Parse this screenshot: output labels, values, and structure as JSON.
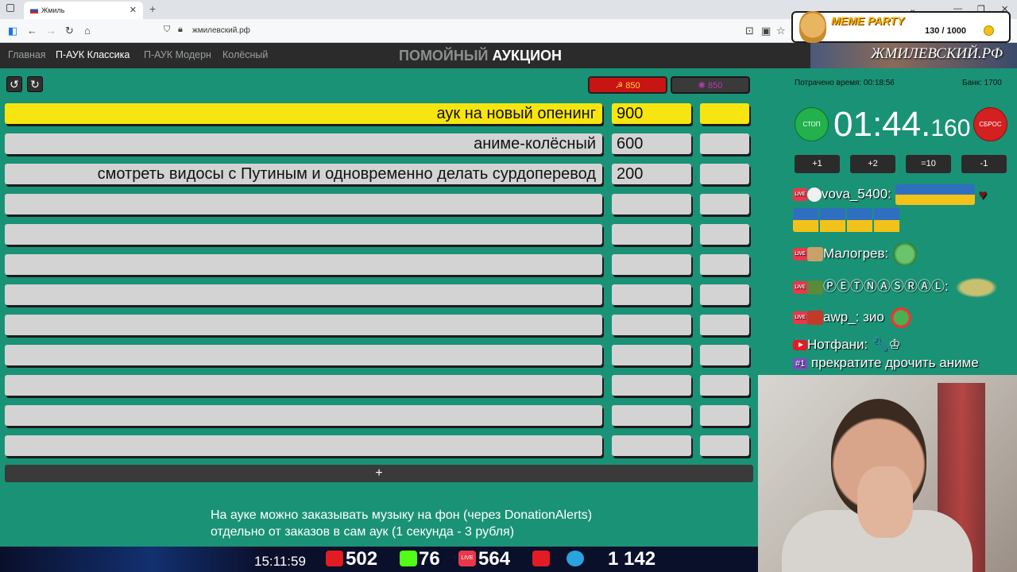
{
  "browser": {
    "tab_title": "Жмиль",
    "url": "жмилевский.рф"
  },
  "meme_party": {
    "title": "MEME PARTY",
    "count": "130 / 1000"
  },
  "nav": {
    "items": [
      "Главная",
      "П-АУК Классика",
      "П-АУК Модерн",
      "Колёсный"
    ],
    "active": "П-АУК Классика",
    "title_part1": "ПОМОЙНЫЙ",
    "title_part2": "АУКЦИОН",
    "banner": "ЖМИЛЕВСКИЙ.РФ"
  },
  "votes": {
    "red": "☭ 850",
    "dark": "850"
  },
  "lots": [
    {
      "name": "аук на новый опенинг",
      "amount": "900",
      "highlight": true
    },
    {
      "name": "аниме-колёсный",
      "amount": "600"
    },
    {
      "name": "смотреть видосы с Путиным и одновременно делать сурдоперевод",
      "amount": "200"
    },
    {
      "name": "",
      "amount": ""
    },
    {
      "name": "",
      "amount": ""
    },
    {
      "name": "",
      "amount": ""
    },
    {
      "name": "",
      "amount": ""
    },
    {
      "name": "",
      "amount": ""
    },
    {
      "name": "",
      "amount": ""
    },
    {
      "name": "",
      "amount": ""
    },
    {
      "name": "",
      "amount": ""
    },
    {
      "name": "",
      "amount": ""
    }
  ],
  "add_lot_label": "+",
  "notice": {
    "line1": "На ауке можно заказывать музыку на фон (через DonationAlerts)",
    "line2": "отдельно от заказов в сам аук (1 секунда - 3 рубля)"
  },
  "timer_panel": {
    "time_spent": "Потрачено время: 00:18:56",
    "bank": "Банк: 1700",
    "stop_label": "СТОП",
    "reset_label": "СБРОС",
    "time_main": "01:44.",
    "time_ms": "160",
    "buttons": [
      "+1",
      "+2",
      "=10",
      "-1"
    ]
  },
  "chat": {
    "messages": [
      {
        "platform": "live",
        "user": "vova_5400:",
        "text": ""
      },
      {
        "platform": "live",
        "user": "Малогрев:",
        "text": ""
      },
      {
        "platform": "live",
        "user": "ⓅⒺⓉⓃⒶⓈⓇⒶⓁ:",
        "text": ""
      },
      {
        "platform": "live",
        "user": "awp_:",
        "text": "зио"
      },
      {
        "platform": "youtube",
        "user": "Нотфани:",
        "text": "",
        "rank": "#1",
        "text2": "прекратите дрочить аниме"
      }
    ]
  },
  "ticker": {
    "clock": "15:11:59",
    "youtube": "502",
    "kick": "76",
    "vk": "564",
    "telegram": "1 142"
  },
  "colors": {
    "page_bg": "#1a9276",
    "highlight": "#f7e50f",
    "cell": "#d3d3d3"
  }
}
